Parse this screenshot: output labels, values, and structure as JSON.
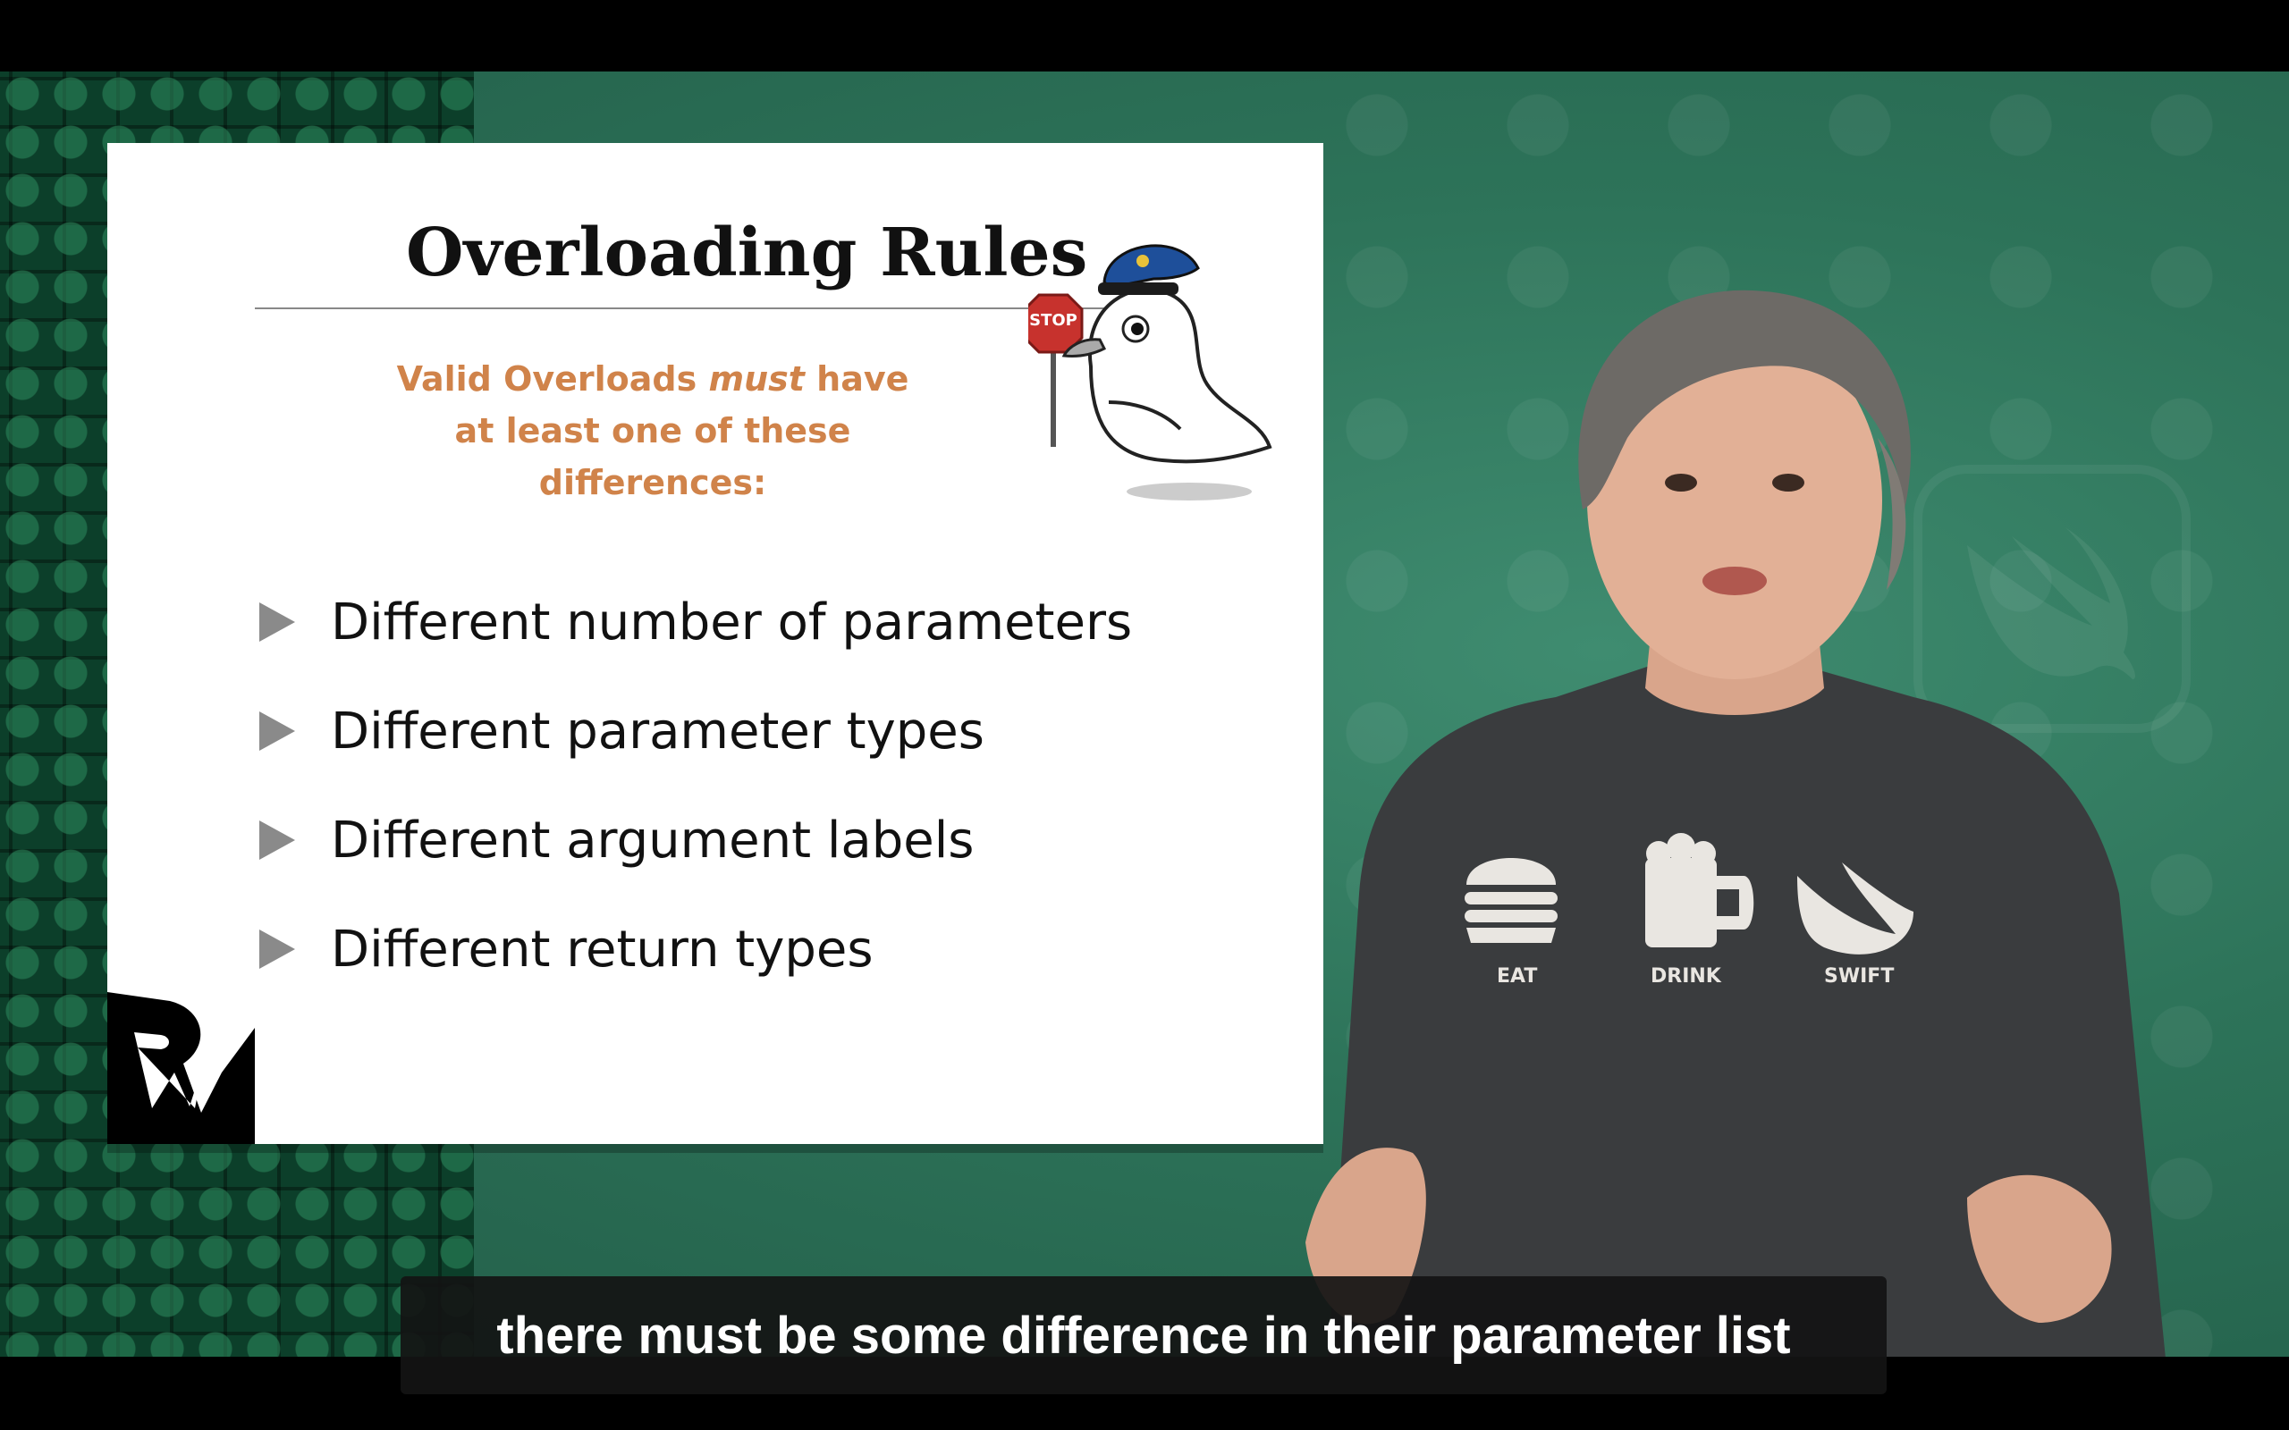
{
  "slide": {
    "title": "Overloading Rules",
    "subtitle_part1": "Valid Overloads ",
    "subtitle_emphasis": "must",
    "subtitle_part2": " have",
    "subtitle_line2": "at least one of these differences:",
    "bullets": [
      "Different number of parameters",
      "Different parameter types",
      "Different argument labels",
      "Different return types"
    ],
    "mascot_sign": "STOP"
  },
  "shirt": {
    "labels": [
      "EAT",
      "DRINK",
      "SWIFT"
    ]
  },
  "caption": {
    "text": "there must be some difference in their parameter list"
  },
  "colors": {
    "accent_orange": "#d0834a",
    "background_green": "#2d7359",
    "caption_bg": "#141414"
  },
  "icons": [
    "stop-sign-icon",
    "police-bird-mascot",
    "rw-logo",
    "burger-icon",
    "beer-mug-icon",
    "swift-bird-icon"
  ]
}
